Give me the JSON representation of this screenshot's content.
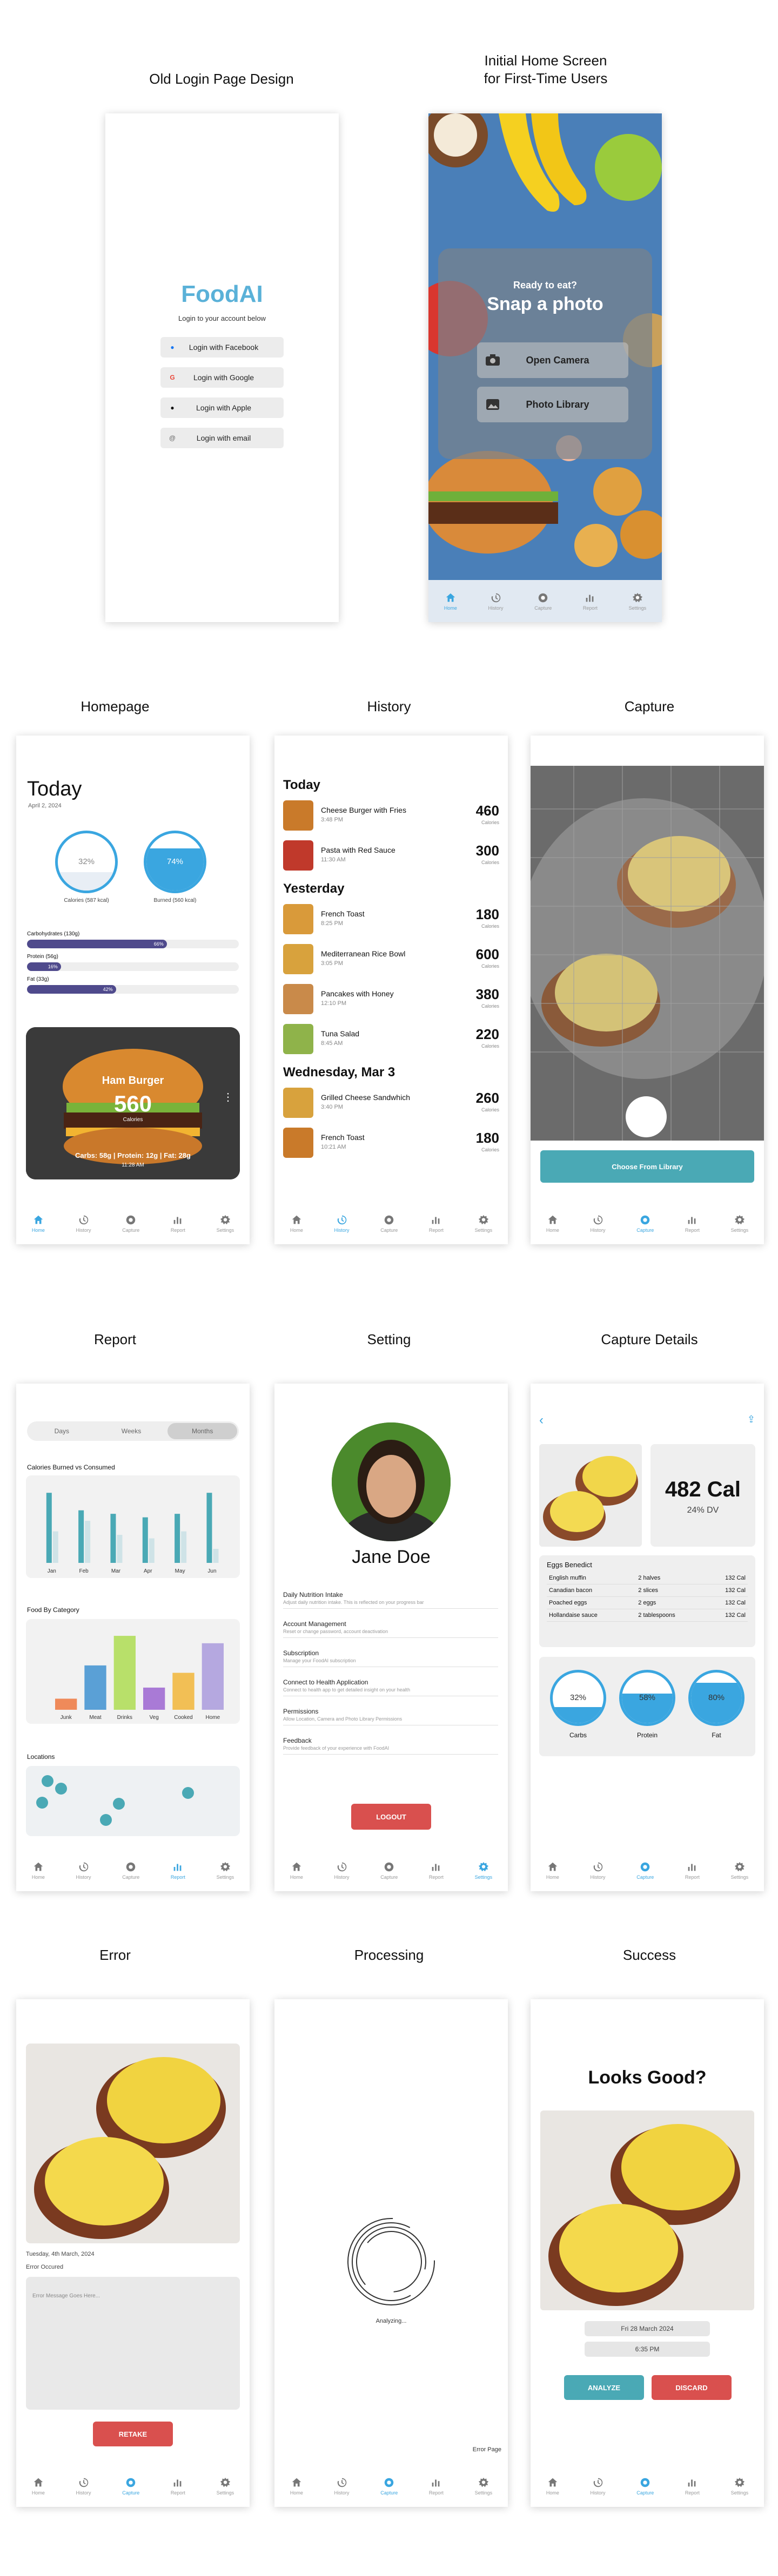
{
  "captions": {
    "old_login": "Old Login Page Design",
    "initial_home": "Initial Home Screen\nfor First-Time Users",
    "homepage": "Homepage",
    "history": "History",
    "capture": "Capture",
    "report": "Report",
    "setting": "Setting",
    "capture_details": "Capture Details",
    "error": "Error",
    "processing": "Processing",
    "success": "Success"
  },
  "tabs": [
    "Home",
    "History",
    "Capture",
    "Report",
    "Settings"
  ],
  "login": {
    "logo": "FoodAI",
    "subtitle": "Login to your account below",
    "buttons": [
      {
        "icon": "facebook-icon",
        "label": "Login with Facebook"
      },
      {
        "icon": "google-icon",
        "label": "Login with Google"
      },
      {
        "icon": "apple-icon",
        "label": "Login with Apple"
      },
      {
        "icon": "email-icon",
        "label": "Login with email"
      }
    ]
  },
  "initial_home": {
    "ready": "Ready to eat?",
    "snap": "Snap a photo",
    "open_camera": "Open Camera",
    "photo_library": "Photo Library"
  },
  "homepage": {
    "title": "Today",
    "date": "April 2, 2024",
    "calories_pct": "32%",
    "calories_label": "Calories (587 kcal)",
    "calories_fraction": 0.32,
    "burned_pct": "74%",
    "burned_label": "Burned (560 kcal)",
    "burned_fraction": 0.74,
    "macros": [
      {
        "label": "Carbohydrates (130g)",
        "pct": "66%",
        "fraction": 0.66
      },
      {
        "label": "Protein (56g)",
        "pct": "16%",
        "fraction": 0.16
      },
      {
        "label": "Fat (33g)",
        "pct": "42%",
        "fraction": 0.42
      }
    ],
    "card_title": "Ham Burger",
    "card_cal": "560",
    "card_unit": "Calories",
    "card_macros": "Carbs: 58g | Protein: 12g | Fat: 28g",
    "card_time": "11:28 AM"
  },
  "history": {
    "groups": [
      {
        "title": "Today",
        "items": [
          {
            "name": "Cheese Burger with Fries",
            "time": "3:48 PM",
            "cal": "460"
          },
          {
            "name": "Pasta with Red Sauce",
            "time": "11:30 AM",
            "cal": "300"
          }
        ]
      },
      {
        "title": "Yesterday",
        "items": [
          {
            "name": "French Toast",
            "time": "8:25 PM",
            "cal": "180"
          },
          {
            "name": "Mediterranean Rice Bowl",
            "time": "3:05 PM",
            "cal": "600"
          },
          {
            "name": "Pancakes with Honey",
            "time": "12:10 PM",
            "cal": "380"
          },
          {
            "name": "Tuna Salad",
            "time": "8:45 AM",
            "cal": "220"
          }
        ]
      },
      {
        "title": "Wednesday, Mar 3",
        "items": [
          {
            "name": "Grilled Cheese Sandwhich",
            "time": "3:40 PM",
            "cal": "260"
          },
          {
            "name": "French Toast",
            "time": "10:21 AM",
            "cal": "180"
          }
        ]
      }
    ],
    "unit": "Calories"
  },
  "capture": {
    "choose": "Choose From Library"
  },
  "report": {
    "segments": [
      "Days",
      "Weeks",
      "Months"
    ],
    "active_segment": "Months",
    "calories_title": "Calories Burned vs Consumed",
    "food_title": "Food By Category",
    "locations_title": "Locations"
  },
  "chart_data": [
    {
      "type": "bar",
      "categories": [
        "Jan",
        "Feb",
        "Mar",
        "Apr",
        "May",
        "Jun"
      ],
      "series": [
        {
          "values": [
            40,
            30,
            28,
            26,
            28,
            40
          ],
          "color": "#4aa9b5"
        },
        {
          "values": [
            18,
            24,
            16,
            14,
            18,
            8
          ],
          "color": "#cfe3e7"
        }
      ],
      "ylim": [
        0,
        45
      ]
    },
    {
      "type": "bar",
      "categories": [
        "Junk",
        "Meat",
        "Drinks",
        "Veg",
        "Cooked",
        "Home"
      ],
      "values": [
        6,
        24,
        40,
        12,
        20,
        36
      ],
      "colors": [
        "#ef8a5a",
        "#5aa0d6",
        "#b8e06a",
        "#a97ad6",
        "#f2bf55",
        "#b5a8e0"
      ],
      "ylim": [
        0,
        45
      ]
    }
  ],
  "setting": {
    "name": "Jane Doe",
    "items": [
      {
        "title": "Daily Nutrition Intake",
        "sub": "Adjust daily nutrition intake. This is reflected on your progress bar"
      },
      {
        "title": "Account Management",
        "sub": "Reset or change password, account deactivation"
      },
      {
        "title": "Subscription",
        "sub": "Manage your FoodAI subscription"
      },
      {
        "title": "Connect to Health Application",
        "sub": "Connect to health app to get detailed insight on your health"
      },
      {
        "title": "Permissions",
        "sub": "Allow Location, Camera and Photo Library Permissions"
      },
      {
        "title": "Feedback",
        "sub": "Provide feedback of your experience with FoodAI"
      }
    ],
    "logout": "LOGOUT"
  },
  "details": {
    "cal": "482 Cal",
    "dv": "24% DV",
    "dish": "Eggs Benedict",
    "ingredients": [
      {
        "name": "English muffin",
        "qty": "2 halves",
        "cal": "132 Cal"
      },
      {
        "name": "Canadian bacon",
        "qty": "2 slices",
        "cal": "132 Cal"
      },
      {
        "name": "Poached eggs",
        "qty": "2 eggs",
        "cal": "132 Cal"
      },
      {
        "name": "Hollandaise sauce",
        "qty": "2 tablespoons",
        "cal": "132 Cal"
      }
    ],
    "rings": [
      {
        "label": "Carbs",
        "pct": "32%",
        "fraction": 0.32
      },
      {
        "label": "Protein",
        "pct": "58%",
        "fraction": 0.58
      },
      {
        "label": "Fat",
        "pct": "80%",
        "fraction": 0.8
      }
    ]
  },
  "error": {
    "date": "Tuesday, 4th March, 2024",
    "label": "Error Occured",
    "placeholder": "Error Message Goes Here...",
    "retake": "RETAKE"
  },
  "processing": {
    "text": "Analyzing...",
    "footer": "Error Page"
  },
  "success": {
    "title": "Looks Good?",
    "date": "Fri 28 March 2024",
    "time": "6:35 PM",
    "analyze": "ANALYZE",
    "discard": "DISCARD"
  }
}
